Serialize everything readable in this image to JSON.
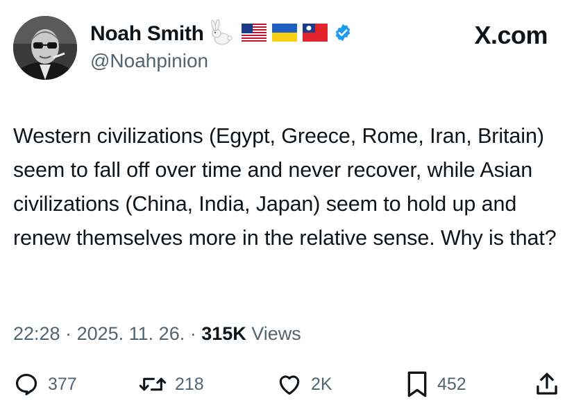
{
  "brand": {
    "name": "X.com"
  },
  "author": {
    "display_name": "Noah Smith",
    "handle": "@Noahpinion",
    "name_emojis": [
      "rabbit-icon",
      "us-flag-icon",
      "ukraine-flag-icon",
      "taiwan-flag-icon"
    ],
    "verified": true,
    "verified_color": "#1d9bf0"
  },
  "post": {
    "text": "Western civilizations (Egypt, Greece, Rome, Iran, Britain) seem to fall off over time and never recover, while Asian civilizations (China, India, Japan) seem to hold up and renew themselves more in the relative sense. Why is that?"
  },
  "meta": {
    "time": "22:28",
    "separator": " · ",
    "date": "2025. 11. 26.",
    "views_count": "315K",
    "views_label": " Views"
  },
  "actions": {
    "replies": "377",
    "reposts": "218",
    "likes": "2K",
    "bookmarks": "452"
  },
  "colors": {
    "text_primary": "#0f1419",
    "text_secondary": "#536471",
    "background": "#ffffff"
  }
}
